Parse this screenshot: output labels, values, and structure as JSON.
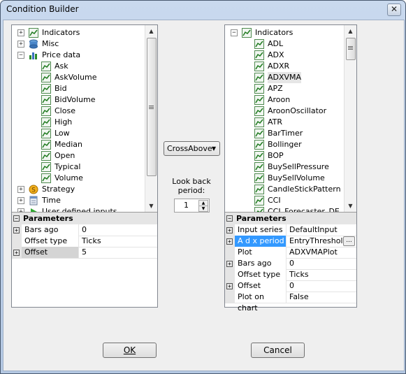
{
  "window": {
    "title": "Condition Builder",
    "close_glyph": "✕"
  },
  "left_tree": {
    "items": [
      {
        "label": "Indicators",
        "expander": "+",
        "icon": "indicators-chart-icon"
      },
      {
        "label": "Misc",
        "expander": "+",
        "icon": "misc-database-icon"
      },
      {
        "label": "Price data",
        "expander": "−",
        "icon": "price-data-bars-icon"
      },
      {
        "label": "Ask",
        "icon": "indicator-chart-icon"
      },
      {
        "label": "AskVolume",
        "icon": "indicator-chart-icon"
      },
      {
        "label": "Bid",
        "icon": "indicator-chart-icon"
      },
      {
        "label": "BidVolume",
        "icon": "indicator-chart-icon"
      },
      {
        "label": "Close",
        "icon": "indicator-chart-icon"
      },
      {
        "label": "High",
        "icon": "indicator-chart-icon"
      },
      {
        "label": "Low",
        "icon": "indicator-chart-icon"
      },
      {
        "label": "Median",
        "icon": "indicator-chart-icon"
      },
      {
        "label": "Open",
        "icon": "indicator-chart-icon"
      },
      {
        "label": "Typical",
        "icon": "indicator-chart-icon"
      },
      {
        "label": "Volume",
        "icon": "indicator-chart-icon"
      },
      {
        "label": "Strategy",
        "expander": "+",
        "icon": "strategy-coin-icon"
      },
      {
        "label": "Time",
        "expander": "+",
        "icon": "time-calendar-icon"
      },
      {
        "label": "User defined inputs",
        "expander": "+",
        "icon": "user-inputs-play-icon"
      }
    ]
  },
  "left_params": {
    "header": "Parameters",
    "rows": [
      {
        "name": "Bars ago",
        "value": "0",
        "expander": "+"
      },
      {
        "name": "Offset type",
        "value": "Ticks"
      },
      {
        "name": "Offset",
        "value": "5",
        "expander": "+"
      }
    ]
  },
  "middle": {
    "operator": "CrossAbove",
    "lookback_label_1": "Look back",
    "lookback_label_2": "period:",
    "lookback_value": "1"
  },
  "right_tree": {
    "items": [
      {
        "label": "Indicators",
        "expander": "−",
        "icon": "indicators-chart-icon"
      },
      {
        "label": "ADL",
        "icon": "indicator-chart-icon"
      },
      {
        "label": "ADX",
        "icon": "indicator-chart-icon"
      },
      {
        "label": "ADXR",
        "icon": "indicator-chart-icon"
      },
      {
        "label": "ADXVMA",
        "icon": "indicator-chart-icon",
        "selected": true
      },
      {
        "label": "APZ",
        "icon": "indicator-chart-icon"
      },
      {
        "label": "Aroon",
        "icon": "indicator-chart-icon"
      },
      {
        "label": "AroonOscillator",
        "icon": "indicator-chart-icon"
      },
      {
        "label": "ATR",
        "icon": "indicator-chart-icon"
      },
      {
        "label": "BarTimer",
        "icon": "indicator-chart-icon"
      },
      {
        "label": "Bollinger",
        "icon": "indicator-chart-icon"
      },
      {
        "label": "BOP",
        "icon": "indicator-chart-icon"
      },
      {
        "label": "BuySellPressure",
        "icon": "indicator-chart-icon"
      },
      {
        "label": "BuySellVolume",
        "icon": "indicator-chart-icon"
      },
      {
        "label": "CandleStickPattern",
        "icon": "indicator-chart-icon"
      },
      {
        "label": "CCI",
        "icon": "indicator-chart-icon"
      },
      {
        "label": "CCI_Forecaster_DE",
        "icon": "indicator-chart-icon"
      }
    ]
  },
  "right_params": {
    "header": "Parameters",
    "rows": [
      {
        "name": "Input series",
        "value": "DefaultInput",
        "expander": "+"
      },
      {
        "name": "A d x period",
        "value": "EntryThreshold",
        "expander": "+",
        "highlight": true,
        "ellipsis": "..."
      },
      {
        "name": "Plot",
        "value": "ADXVMAPlot"
      },
      {
        "name": "Bars ago",
        "value": "0",
        "expander": "+"
      },
      {
        "name": "Offset type",
        "value": "Ticks"
      },
      {
        "name": "Offset",
        "value": "0",
        "expander": "+"
      },
      {
        "name": "Plot on chart",
        "value": "False"
      }
    ]
  },
  "buttons": {
    "ok": "OK",
    "cancel": "Cancel"
  },
  "colors": {
    "selection": "#3399ff",
    "title_gradient": "#c9d9ee",
    "dialog_bg": "#efefef"
  }
}
